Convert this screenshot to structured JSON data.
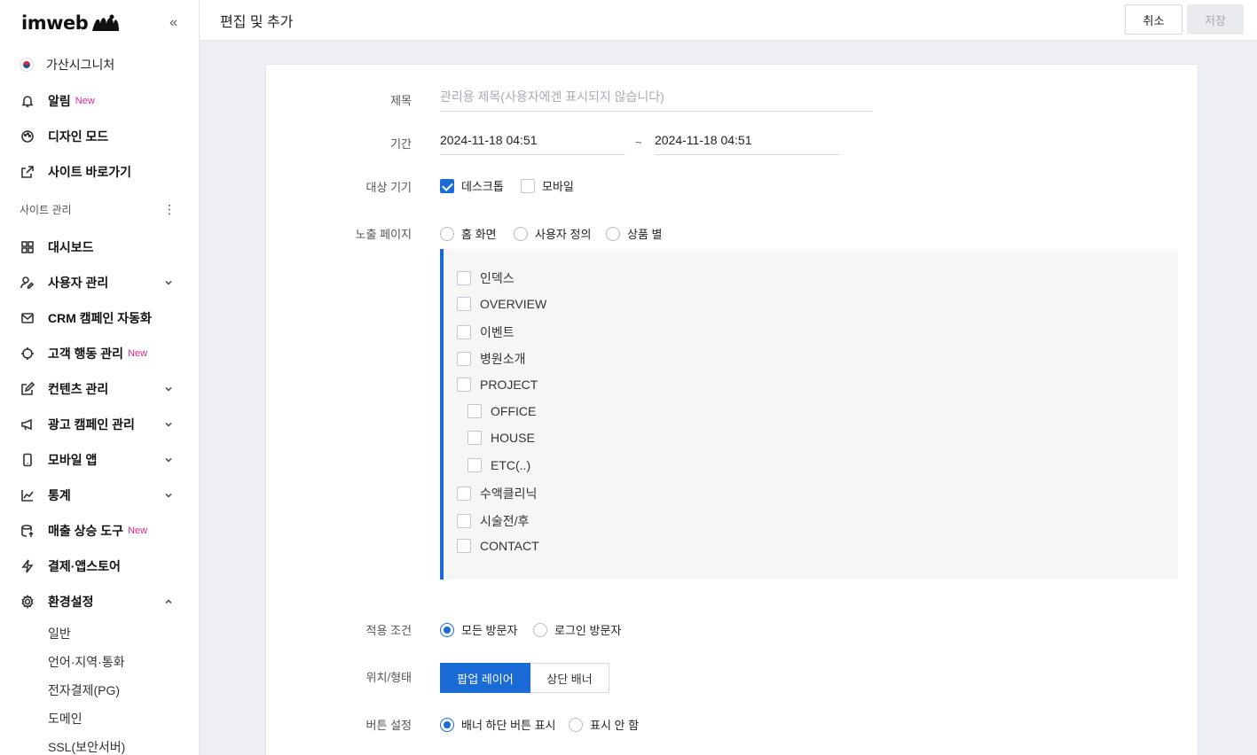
{
  "brand": {
    "logo_text": "imweb",
    "collapse_icon": "double-chevron-left-icon"
  },
  "site": {
    "name": "가산시그니처"
  },
  "nav_top": [
    {
      "label": "알림",
      "badge": "New",
      "icon": "bell-icon"
    },
    {
      "label": "디자인 모드",
      "badge": "",
      "icon": "palette-icon"
    },
    {
      "label": "사이트 바로가기",
      "badge": "",
      "icon": "external-link-icon"
    }
  ],
  "section": {
    "title": "사이트 관리"
  },
  "nav_main": [
    {
      "label": "대시보드",
      "badge": "",
      "icon": "grid-icon",
      "chevron": ""
    },
    {
      "label": "사용자 관리",
      "badge": "",
      "icon": "user-edit-icon",
      "chevron": "down"
    },
    {
      "label": "CRM 캠페인 자동화",
      "badge": "",
      "icon": "mail-icon",
      "chevron": ""
    },
    {
      "label": "고객 행동 관리",
      "badge": "New",
      "icon": "crosshair-icon",
      "chevron": ""
    },
    {
      "label": "컨텐츠 관리",
      "badge": "",
      "icon": "edit-icon",
      "chevron": "down"
    },
    {
      "label": "광고 캠페인 관리",
      "badge": "",
      "icon": "megaphone-icon",
      "chevron": "down"
    },
    {
      "label": "모바일 앱",
      "badge": "",
      "icon": "phone-icon",
      "chevron": "down"
    },
    {
      "label": "통계",
      "badge": "",
      "icon": "chart-icon",
      "chevron": "down"
    },
    {
      "label": "매출 상승 도구",
      "badge": "New",
      "icon": "database-up-icon",
      "chevron": ""
    },
    {
      "label": "결제·앱스토어",
      "badge": "",
      "icon": "bolt-icon",
      "chevron": ""
    },
    {
      "label": "환경설정",
      "badge": "",
      "icon": "gear-icon",
      "chevron": "up"
    }
  ],
  "nav_sub": [
    "일반",
    "언어·지역·통화",
    "전자결제(PG)",
    "도메인",
    "SSL(보안서버)"
  ],
  "header": {
    "title": "편집 및 추가",
    "cancel": "취소",
    "save": "저장"
  },
  "form": {
    "title_label": "제목",
    "title_placeholder": "관리용 제목(사용자에겐 표시되지 않습니다)",
    "period_label": "기간",
    "period_start": "2024-11-18 04:51",
    "period_sep": "~",
    "period_end": "2024-11-18 04:51",
    "device_label": "대상 기기",
    "device_desktop": "데스크톱",
    "device_desktop_checked": true,
    "device_mobile": "모바일",
    "device_mobile_checked": false,
    "exposure_label": "노출 페이지",
    "exposure_options": [
      "홈 화면",
      "사용자 정의",
      "상품 별"
    ],
    "pages": [
      {
        "label": "인덱스",
        "level": 0
      },
      {
        "label": "OVERVIEW",
        "level": 0
      },
      {
        "label": "이벤트",
        "level": 0
      },
      {
        "label": "병원소개",
        "level": 0
      },
      {
        "label": "PROJECT",
        "level": 0
      },
      {
        "label": "OFFICE",
        "level": 1
      },
      {
        "label": "HOUSE",
        "level": 1
      },
      {
        "label": "ETC(..)",
        "level": 1
      },
      {
        "label": "수액클리닉",
        "level": 0
      },
      {
        "label": "시술전/후",
        "level": 0
      },
      {
        "label": "CONTACT",
        "level": 0
      }
    ],
    "condition_label": "적용 조건",
    "condition_options": [
      "모든 방문자",
      "로그인 방문자"
    ],
    "condition_selected": "모든 방문자",
    "position_label": "위치/형태",
    "position_options": [
      "팝업 레이어",
      "상단 배너"
    ],
    "position_selected": "팝업 레이어",
    "button_label": "버튼 설정",
    "button_options": [
      "배너 하단 버튼 표시",
      "표시 안 함"
    ],
    "button_selected": "배너 하단 버튼 표시"
  },
  "colors": {
    "accent": "#1b6bd6",
    "new_badge": "#e6288f"
  }
}
